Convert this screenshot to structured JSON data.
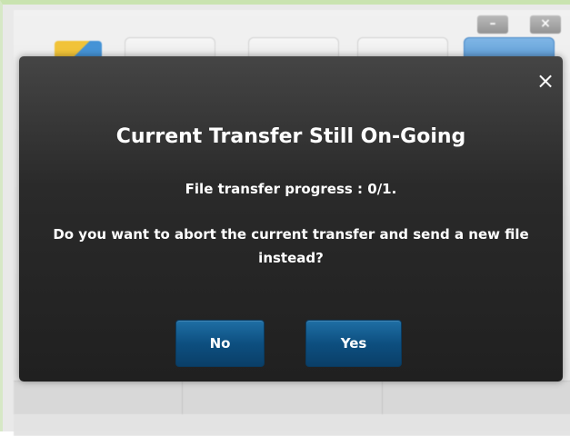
{
  "background": {
    "window_controls": {
      "minimize": "–",
      "close": "×"
    }
  },
  "dialog": {
    "close": "×",
    "title": "Current Transfer Still On-Going",
    "progress_text": "File transfer progress : 0/1.",
    "question_text": "Do you want to abort the current transfer and send a new file instead?",
    "buttons": {
      "no": "No",
      "yes": "Yes"
    }
  },
  "colors": {
    "dialog_bg": "#2a2a2a",
    "button_bg": "#0d4f80",
    "frame_accent": "#c9e3b0"
  }
}
